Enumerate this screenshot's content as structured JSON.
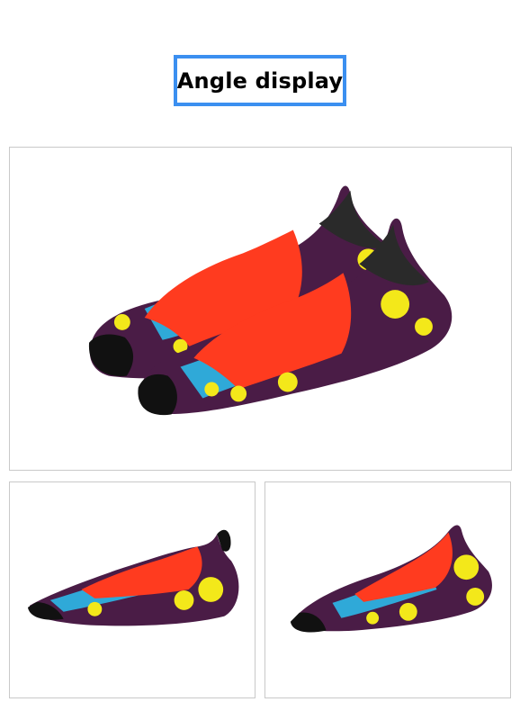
{
  "header": {
    "title": "Angle display"
  },
  "colors": {
    "frame": "#3b8ff0",
    "upper_red": "#ff3b1f",
    "pattern_purple": "#4a1c46",
    "pattern_cyan": "#2fa9d8",
    "pattern_yellow": "#f3e81a",
    "sole_black": "#111111"
  },
  "gallery": {
    "main": {
      "icon": "water-shoe-pair-image"
    },
    "bottom_left": {
      "icon": "water-shoe-side-image"
    },
    "bottom_right": {
      "icon": "water-shoe-angle-image"
    }
  }
}
